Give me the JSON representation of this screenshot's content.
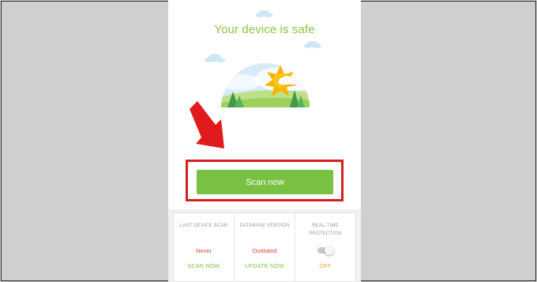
{
  "main": {
    "status_title": "Your device is safe",
    "scan_button_label": "Scan now"
  },
  "status_card": {
    "columns": [
      {
        "label": "LAST DEVICE SCAN",
        "value": "Never",
        "action": "SCAN NOW"
      },
      {
        "label": "DATABASE VERSION",
        "value": "Outdated",
        "action": "UPDATE NOW"
      },
      {
        "label": "REAL-TIME PROTECTION",
        "toggle_on": false,
        "action": "OFF"
      }
    ]
  },
  "colors": {
    "accent_green": "#78c142",
    "title_green": "#8cc63f",
    "warning_red": "#d8483a",
    "off_orange": "#f0a020",
    "highlight_red": "#d51f1f"
  }
}
